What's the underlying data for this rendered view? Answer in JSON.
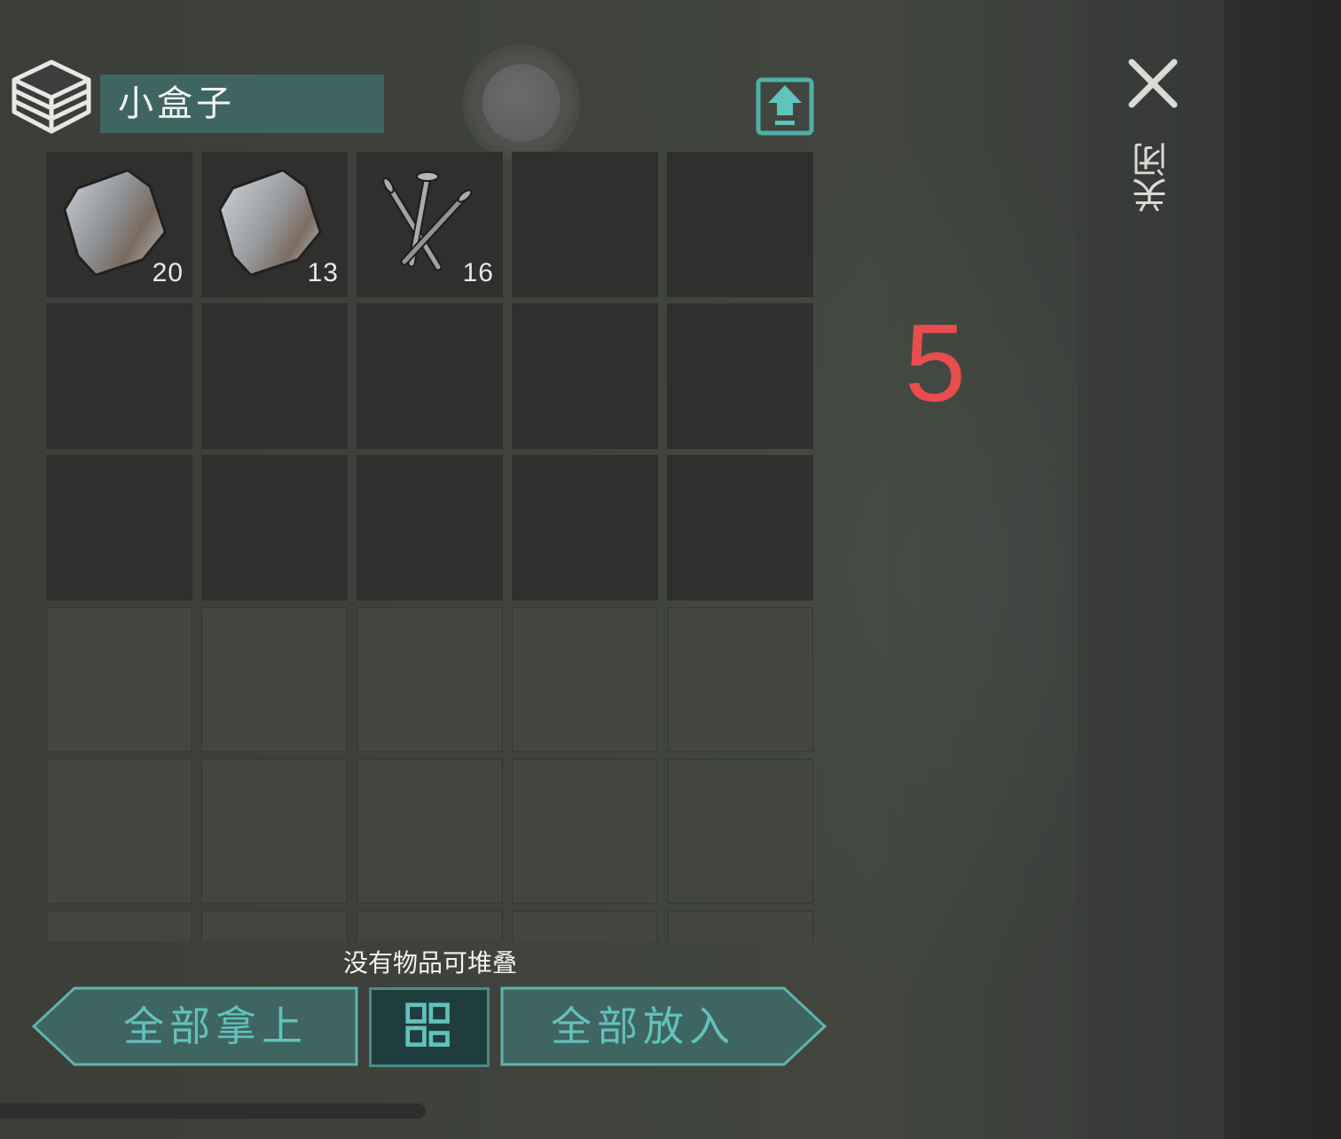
{
  "container": {
    "title": "小盒子",
    "icon": "box-icon"
  },
  "toolbar": {
    "upload_icon": "upload-icon"
  },
  "close": {
    "label": "关闭",
    "icon": "close-icon"
  },
  "overlay_number": "5",
  "inventory": {
    "slots": [
      {
        "item": "metal-plate-icon",
        "count": "20"
      },
      {
        "item": "metal-plate-icon",
        "count": "13"
      },
      {
        "item": "nails-icon",
        "count": "16"
      },
      {
        "item": "",
        "count": ""
      },
      {
        "item": "",
        "count": ""
      }
    ]
  },
  "status_message": "没有物品可堆叠",
  "buttons": {
    "take_all": "全部拿上",
    "sort_icon": "sort-grid-icon",
    "put_all": "全部放入"
  },
  "colors": {
    "accent": "#62c2bc",
    "title_bg": "#3f6562",
    "overlay_number": "#e94d4d"
  }
}
